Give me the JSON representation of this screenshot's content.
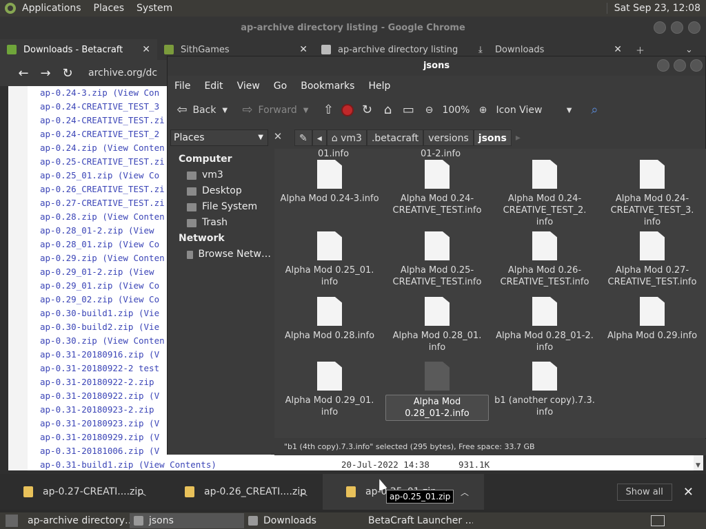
{
  "top_panel": {
    "menus": [
      "Applications",
      "Places",
      "System"
    ],
    "clock": "Sat Sep 23, 12:08"
  },
  "chrome": {
    "title": "ap-archive directory listing - Google Chrome",
    "tabs": [
      {
        "label": "Downloads - Betacraft",
        "icon": "betacraft-icon"
      },
      {
        "label": "SithGames",
        "icon": "grass-block-icon"
      },
      {
        "label": "ap-archive directory listing",
        "icon": "archive-icon"
      },
      {
        "label": "Downloads",
        "icon": "download-icon"
      }
    ],
    "address": "archive.org/dc",
    "listing": [
      {
        "name": "ap-0.24-3.zip",
        "tail": " (View Con"
      },
      {
        "name": "ap-0.24-CREATIVE_TEST_3",
        "tail": ""
      },
      {
        "name": "ap-0.24-CREATIVE_TEST.zi",
        "tail": ""
      },
      {
        "name": "ap-0.24-CREATIVE_TEST_2",
        "tail": ""
      },
      {
        "name": "ap-0.24.zip",
        "tail": " (View Conten"
      },
      {
        "name": "ap-0.25-CREATIVE_TEST.zi",
        "tail": ""
      },
      {
        "name": "ap-0.25_01.zip",
        "tail": " (View Co"
      },
      {
        "name": "ap-0.26_CREATIVE_TEST.zi",
        "tail": ""
      },
      {
        "name": "ap-0.27-CREATIVE_TEST.zi",
        "tail": ""
      },
      {
        "name": "ap-0.28.zip",
        "tail": " (View Conten"
      },
      {
        "name": "ap-0.28_01-2.zip",
        "tail": " (View"
      },
      {
        "name": "ap-0.28_01.zip",
        "tail": " (View Co"
      },
      {
        "name": "ap-0.29.zip",
        "tail": " (View Conten"
      },
      {
        "name": "ap-0.29_01-2.zip",
        "tail": " (View"
      },
      {
        "name": "ap-0.29_01.zip",
        "tail": " (View Co"
      },
      {
        "name": "ap-0.29_02.zip",
        "tail": " (View Co"
      },
      {
        "name": "ap-0.30-build1.zip",
        "tail": " (Vie"
      },
      {
        "name": "ap-0.30-build2.zip",
        "tail": " (Vie"
      },
      {
        "name": "ap-0.30.zip",
        "tail": " (View Conten"
      },
      {
        "name": "ap-0.31-20180916.zip",
        "tail": " (V"
      },
      {
        "name": "ap-0.31-20180922-2 test",
        "tail": ""
      },
      {
        "name": "ap-0.31-20180922-2.zip",
        "tail": ""
      },
      {
        "name": "ap-0.31-20180922.zip",
        "tail": " (V"
      },
      {
        "name": "ap-0.31-20180923-2.zip",
        "tail": ""
      },
      {
        "name": "ap-0.31-20180923.zip",
        "tail": " (V"
      },
      {
        "name": "ap-0.31-20180929.zip",
        "tail": " (V"
      },
      {
        "name": "ap-0.31-20181006.zip",
        "tail": " (V"
      },
      {
        "name": "ap-0.31-build1.zip",
        "tail": " (View Contents)",
        "date": "20-Jul-2022 14:38",
        "size": "931.1K"
      }
    ]
  },
  "file_manager": {
    "title": "jsons",
    "menus": [
      "File",
      "Edit",
      "View",
      "Go",
      "Bookmarks",
      "Help"
    ],
    "toolbar": {
      "back": "Back",
      "forward": "Forward",
      "zoom": "100%",
      "view": "Icon View"
    },
    "places_label": "Places",
    "crumbs": [
      "vm3",
      ".betacraft",
      "versions",
      "jsons"
    ],
    "sidebar": {
      "computer_head": "Computer",
      "computer_items": [
        "vm3",
        "Desktop",
        "File System",
        "Trash"
      ],
      "network_head": "Network",
      "network_items": [
        "Browse Netw…"
      ]
    },
    "top_clipped": [
      "01.info",
      "01-2.info"
    ],
    "files": [
      [
        "Alpha Mod 0.24-3.info"
      ],
      [
        "Alpha Mod 0.24-",
        "CREATIVE_TEST.info"
      ],
      [
        "Alpha Mod 0.24-",
        "CREATIVE_TEST_2.",
        "info"
      ],
      [
        "Alpha Mod 0.24-",
        "CREATIVE_TEST_3.",
        "info"
      ],
      [
        "Alpha Mod 0.25_01.",
        "info"
      ],
      [
        "Alpha Mod 0.25-",
        "CREATIVE_TEST.info"
      ],
      [
        "Alpha Mod 0.26-",
        "CREATIVE_TEST.info"
      ],
      [
        "Alpha Mod 0.27-",
        "CREATIVE_TEST.info"
      ],
      [
        "Alpha Mod 0.28.info"
      ],
      [
        "Alpha Mod 0.28_01.",
        "info"
      ],
      [
        "Alpha Mod 0.28_01-2.",
        "info"
      ],
      [
        "Alpha Mod 0.29.info"
      ],
      [
        "Alpha Mod 0.29_01.",
        "info"
      ],
      [
        "Alpha Mod",
        "0.28_01-2.info"
      ],
      [
        "b1 (another copy).7.3.",
        "info"
      ]
    ],
    "status": "\"b1 (4th copy).7.3.info\" selected (295 bytes), Free space: 33.7 GB"
  },
  "downloads_bar": {
    "items": [
      "ap-0.27-CREATI....zip",
      "ap-0.26_CREATI....zip",
      "ap-0.25_01.zip"
    ],
    "show_all": "Show all",
    "tooltip": "ap-0.25_01.zip"
  },
  "taskbar": {
    "items": [
      "ap-archive directory…",
      "jsons",
      "Downloads",
      "BetaCraft Launcher …"
    ]
  }
}
